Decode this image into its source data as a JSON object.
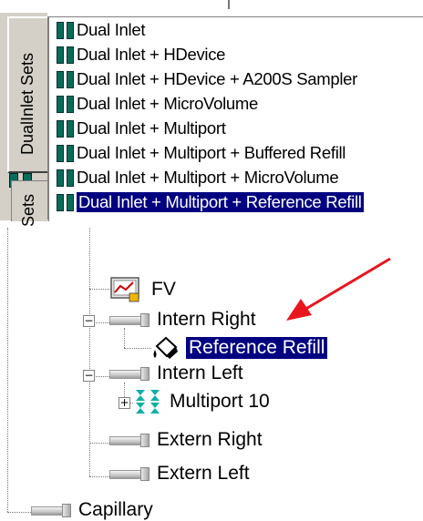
{
  "dualinlet_panel": {
    "tab_active_label": "DualInlet Sets",
    "tab_second_label": "Sets",
    "items": [
      "Dual Inlet",
      "Dual Inlet + HDevice",
      "Dual Inlet + HDevice + A200S Sampler",
      "Dual Inlet + MicroVolume",
      "Dual Inlet + Multiport",
      "Dual Inlet + Multiport + Buffered Refill",
      "Dual Inlet + Multiport + MicroVolume",
      "Dual Inlet + Multiport + Reference Refill"
    ],
    "selected_item": "Dual Inlet + Multiport + Reference Refill"
  },
  "tree": {
    "fv_label": "FV",
    "intern_right_label": "Intern Right",
    "reference_refill_label": "Reference Refill",
    "intern_left_label": "Intern Left",
    "multiport_label": "Multiport 10",
    "extern_right_label": "Extern Right",
    "extern_left_label": "Extern Left",
    "capillary_label": "Capillary",
    "expander_minus": "−",
    "expander_plus": "+"
  },
  "colors": {
    "selection_bg": "#000080",
    "annotation_arrow": "#e8161e",
    "tab_face": "#d4d0c8",
    "inlet_icon": "#0a6a58"
  }
}
